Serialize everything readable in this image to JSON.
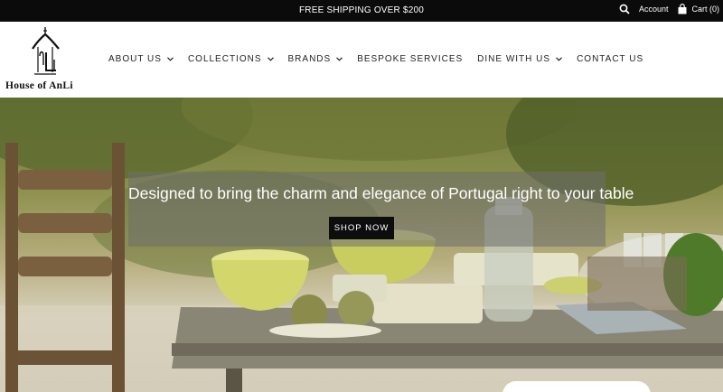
{
  "topbar": {
    "promo": "FREE SHIPPING OVER $200",
    "search_icon": "search-icon",
    "account_label": "Account",
    "cart_label": "Cart (0)",
    "cart_icon": "shopping-bag-icon"
  },
  "header": {
    "logo_text": "House of AnLi",
    "nav": [
      {
        "label": "ABOUT US",
        "has_dropdown": true
      },
      {
        "label": "COLLECTIONS",
        "has_dropdown": true
      },
      {
        "label": "BRANDS",
        "has_dropdown": true
      },
      {
        "label": "BESPOKE SERVICES",
        "has_dropdown": false
      },
      {
        "label": "DINE WITH US",
        "has_dropdown": true
      },
      {
        "label": "CONTACT US",
        "has_dropdown": false
      }
    ]
  },
  "hero": {
    "headline": "Designed to bring the charm and elegance of Portugal right to your table",
    "cta": "SHOP NOW"
  },
  "colors": {
    "topbar_bg": "#0b0b0b",
    "cta_bg": "#0d0d0d",
    "caption_overlay": "rgba(110,110,110,0.55)"
  }
}
